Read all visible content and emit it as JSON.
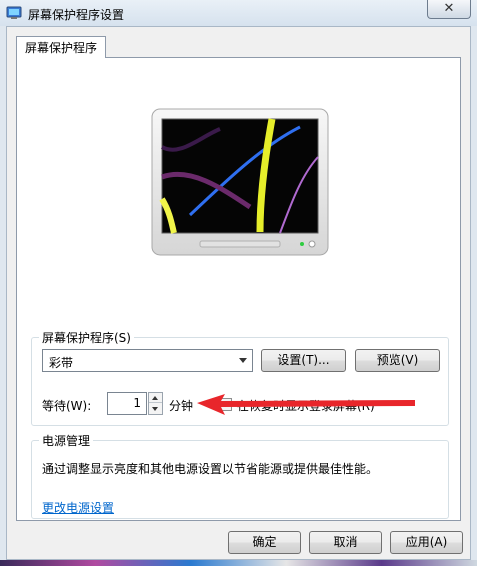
{
  "window": {
    "title": "屏幕保护程序设置",
    "close_label": "✕",
    "icon": "screensaver-app-icon"
  },
  "tabs": [
    {
      "label": "屏幕保护程序",
      "selected": true
    }
  ],
  "screensaver": {
    "group_label": "屏幕保护程序(S)",
    "selected": "彩带",
    "settings_label": "设置(T)...",
    "preview_label": "预览(V)",
    "wait_label": "等待(W):",
    "wait_value": "1",
    "wait_unit": "分钟",
    "resume_label": "在恢复时显示登录屏幕(R)",
    "resume_checked": false
  },
  "power": {
    "group_label": "电源管理",
    "description": "通过调整显示亮度和其他电源设置以节省能源或提供最佳性能。",
    "link_label": "更改电源设置"
  },
  "footer": {
    "ok_label": "确定",
    "cancel_label": "取消",
    "apply_label": "应用(A)"
  },
  "colors": {
    "accent_arrow": "#e8262b",
    "link": "#0066cc"
  }
}
